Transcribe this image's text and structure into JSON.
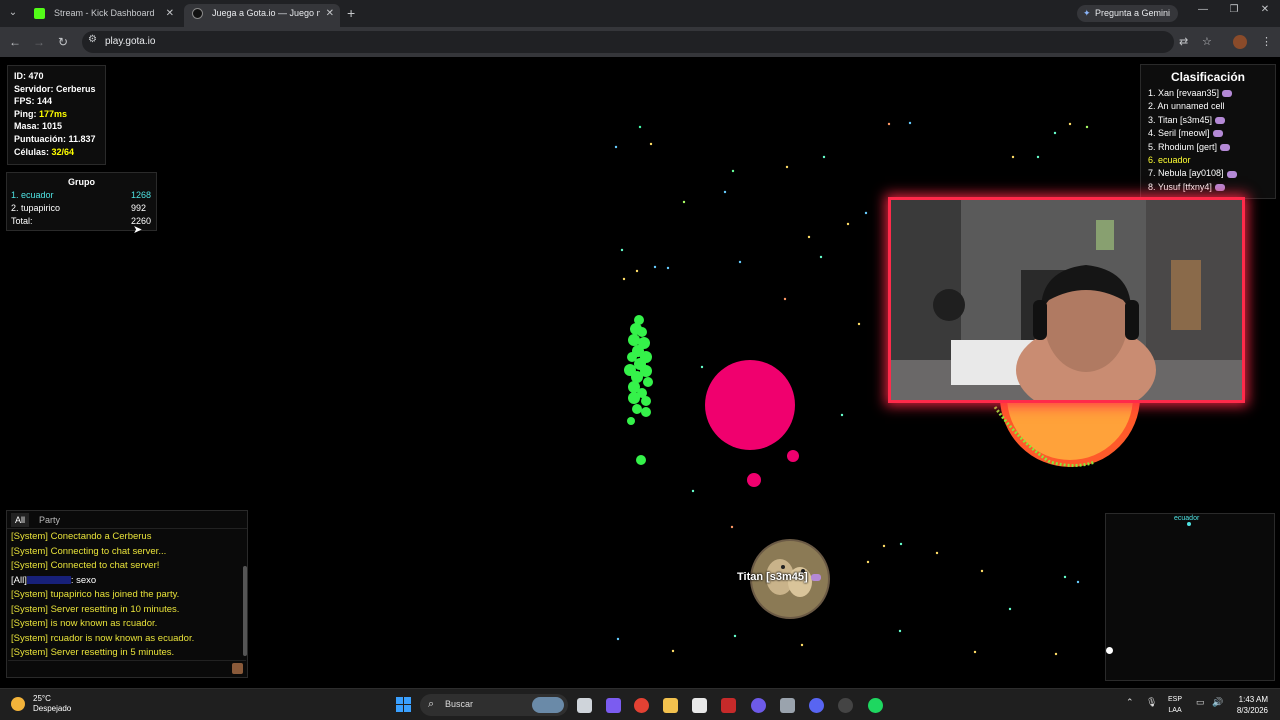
{
  "browser": {
    "tabs": [
      {
        "title": "Stream - Kick Dashboard",
        "favicon_color": "#53fc18",
        "active": false
      },
      {
        "title": "Juega a Gota.io — Juego multi",
        "favicon_color": "#111111",
        "active": true
      }
    ],
    "gemini_label": "Pregunta a Gemini",
    "url": "play.gota.io"
  },
  "stats": {
    "id": "ID: 470",
    "server": "Servidor: Cerberus",
    "fps": "FPS: 144",
    "ping_label": "Ping: ",
    "ping_value": "177ms",
    "mass": "Masa: 1015",
    "score": "Puntuación: 11.837",
    "cells_label": "Células: ",
    "cells_value": "32/64"
  },
  "group": {
    "title": "Grupo",
    "rows": [
      {
        "name": "1. ecuador",
        "value": "1268"
      },
      {
        "name": "2. tupapirico",
        "value": "992"
      },
      {
        "name": "Total:",
        "value": "2260"
      }
    ]
  },
  "leaderboard": {
    "title": "Clasificación",
    "rows": [
      {
        "text": "1. Xan [revaan35]",
        "crown": true
      },
      {
        "text": "2. An unnamed cell",
        "crown": false
      },
      {
        "text": "3. Titan [s3m45]",
        "crown": true
      },
      {
        "text": "4. Seril [meowl]",
        "crown": true
      },
      {
        "text": "5. Rhodium [gert]",
        "crown": true
      },
      {
        "text": "6. ecuador",
        "crown": false
      },
      {
        "text": "7. Nebula [ay0108]",
        "crown": true
      },
      {
        "text": "8. Yusuf [tfxny4]",
        "crown": true
      }
    ]
  },
  "chat": {
    "tabs": [
      "All",
      "Party"
    ],
    "lines": [
      "[System] Conectando a Cerberus",
      "[System] Connecting to chat server...",
      "[System] Connected to chat server!",
      "[System] tupapirico has joined the party.",
      "[System] Server resetting in 10 minutes.",
      "[System] is now known as rcuador.",
      "[System] rcuador is now known as ecuador.",
      "[System] Server resetting in 5 minutes."
    ],
    "all_prefix": "[All]",
    "all_message": ": sexo"
  },
  "minimap": {
    "player_label": "ecuador"
  },
  "game": {
    "titan_label": "Titan [s3m45]",
    "colors": {
      "player_green": "#35f24a",
      "enemy_pink": "#f0006e",
      "sun_orange": "#ff8a2a"
    }
  },
  "taskbar": {
    "temperature": "25°C",
    "weather": "Despejado",
    "search": "Buscar",
    "lang_top": "ESP",
    "lang_bottom": "LAA",
    "time": "1:43 AM",
    "date": "8/3/2026"
  }
}
